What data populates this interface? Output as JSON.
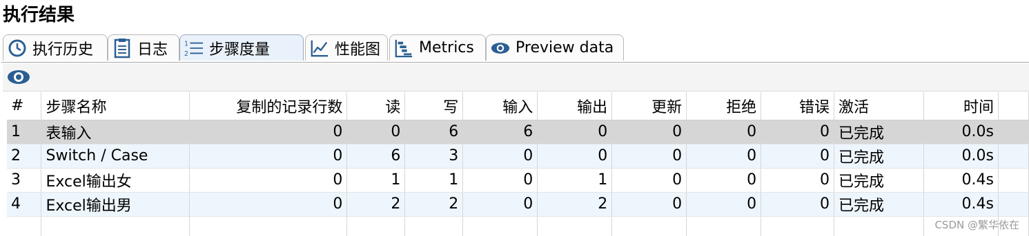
{
  "header": {
    "title": "执行结果"
  },
  "tabs": [
    {
      "label": "执行历史",
      "icon": "clock-icon"
    },
    {
      "label": "日志",
      "icon": "log-document-icon"
    },
    {
      "label": "步骤度量",
      "icon": "numbered-list-icon",
      "active": true
    },
    {
      "label": "性能图",
      "icon": "performance-chart-icon"
    },
    {
      "label": "Metrics",
      "icon": "metrics-bars-icon"
    },
    {
      "label": "Preview data",
      "icon": "eye-icon"
    }
  ],
  "toolbar": {
    "icon": "eye-icon"
  },
  "table": {
    "columns": [
      "#",
      "步骤名称",
      "复制的记录行数",
      "读",
      "写",
      "输入",
      "输出",
      "更新",
      "拒绝",
      "错误",
      "激活",
      "时间"
    ],
    "rows": [
      [
        "1",
        "表输入",
        "0",
        "0",
        "6",
        "6",
        "0",
        "0",
        "0",
        "0",
        "已完成",
        "0.0s"
      ],
      [
        "2",
        "Switch / Case",
        "0",
        "6",
        "3",
        "0",
        "0",
        "0",
        "0",
        "0",
        "已完成",
        "0.0s"
      ],
      [
        "3",
        "Excel输出女",
        "0",
        "1",
        "1",
        "0",
        "1",
        "0",
        "0",
        "0",
        "已完成",
        "0.4s"
      ],
      [
        "4",
        "Excel输出男",
        "0",
        "2",
        "2",
        "0",
        "2",
        "0",
        "0",
        "0",
        "已完成",
        "0.4s"
      ]
    ]
  },
  "watermark": "CSDN @繁华依在",
  "colors": {
    "selected_row": "#d6d6d6",
    "alt_row": "#eef6fd",
    "icon_blue": "#2b5f93"
  }
}
